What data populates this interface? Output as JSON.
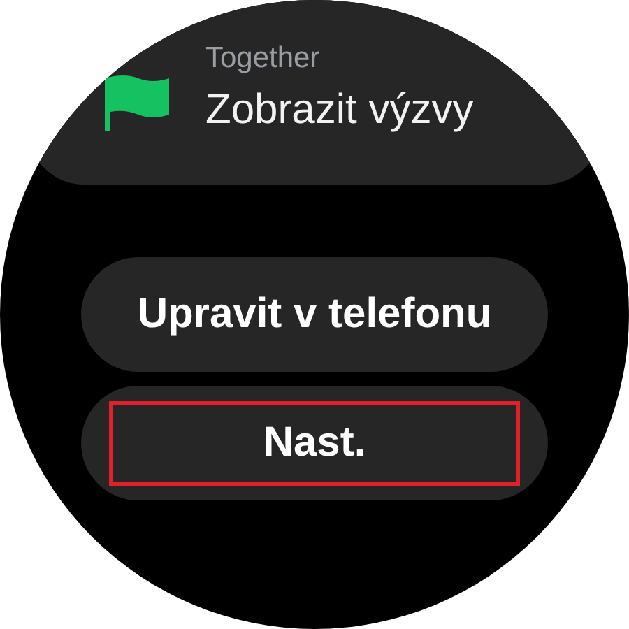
{
  "card": {
    "app": "Together",
    "title": "Zobrazit výzvy"
  },
  "buttons": [
    {
      "label": "Upravit v telefonu",
      "highlighted": false
    },
    {
      "label": "Nast.",
      "highlighted": true
    }
  ]
}
